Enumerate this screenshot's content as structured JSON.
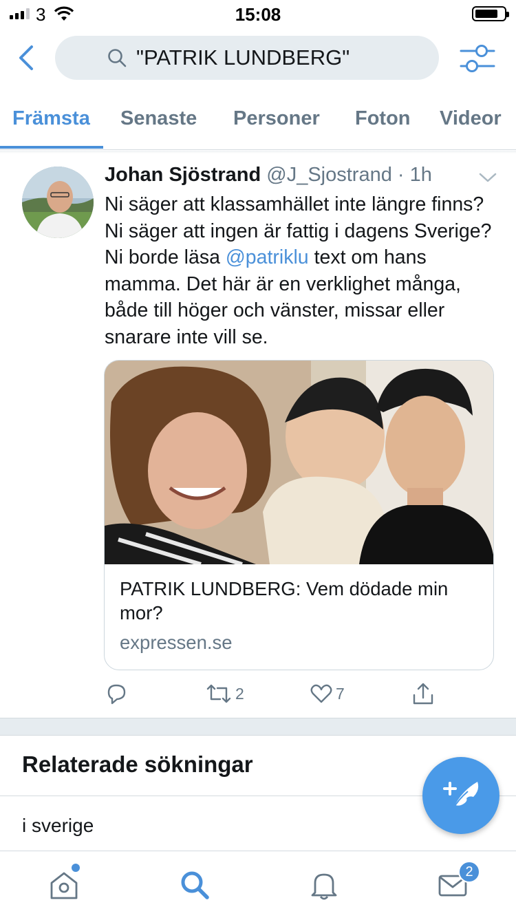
{
  "status_bar": {
    "carrier": "3",
    "time": "15:08"
  },
  "search": {
    "query": "\"PATRIK LUNDBERG\""
  },
  "tabs": [
    {
      "label": "Främsta",
      "active": true
    },
    {
      "label": "Senaste",
      "active": false
    },
    {
      "label": "Personer",
      "active": false
    },
    {
      "label": "Foton",
      "active": false
    },
    {
      "label": "Videor",
      "active": false
    }
  ],
  "tweet": {
    "author_name": "Johan Sjöstrand",
    "handle": "@J_Sjostrand",
    "separator": "·",
    "time": "1h",
    "text_before_mention": "Ni säger att klassamhället inte längre finns? Ni säger att ingen är fattig i dagens Sverige? Ni borde läsa ",
    "mention": "@patriklu",
    "text_after_mention": " text om hans mamma. Det här är en verklighet många, både till höger och vänster, missar eller snarare inte vill se.",
    "card": {
      "title": "PATRIK LUNDBERG: Vem dödade min mor?",
      "domain": "expressen.se"
    },
    "actions": {
      "replies": "",
      "retweets": "2",
      "likes": "7"
    }
  },
  "related": {
    "title": "Relaterade sökningar",
    "items": [
      "i sverige"
    ]
  },
  "bottom_nav": {
    "messages_badge": "2"
  },
  "colors": {
    "accent": "#4a90d9",
    "muted_text": "#657786",
    "divider": "#e6ecf0"
  }
}
